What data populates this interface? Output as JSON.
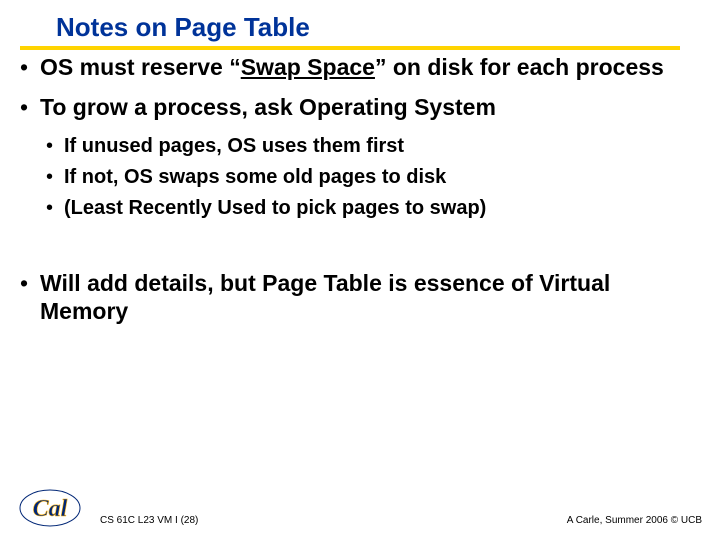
{
  "title": "Notes on Page Table",
  "bullets": {
    "b1_pre": "OS must reserve “",
    "b1_swap": "Swap Space",
    "b1_post": "” on disk for each process",
    "b2": "To grow a process, ask Operating System",
    "b2a": "If unused pages, OS uses them first",
    "b2b": "If not, OS swaps some old pages to disk",
    "b2c": "(Least Recently Used to pick pages to swap)",
    "b3": "Will add details, but Page Table is essence of Virtual Memory"
  },
  "footer": {
    "left": "CS 61C L23 VM I (28)",
    "right": "A Carle, Summer 2006 © UCB"
  },
  "bullet_char": "•"
}
